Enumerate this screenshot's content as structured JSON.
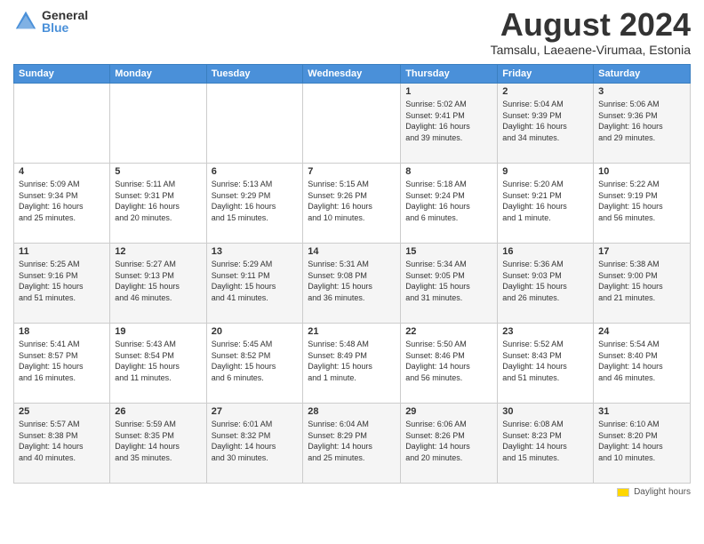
{
  "logo": {
    "general": "General",
    "blue": "Blue"
  },
  "header": {
    "month": "August 2024",
    "location": "Tamsalu, Laeaene-Virumaa, Estonia"
  },
  "days_of_week": [
    "Sunday",
    "Monday",
    "Tuesday",
    "Wednesday",
    "Thursday",
    "Friday",
    "Saturday"
  ],
  "weeks": [
    [
      {
        "day": "",
        "info": ""
      },
      {
        "day": "",
        "info": ""
      },
      {
        "day": "",
        "info": ""
      },
      {
        "day": "",
        "info": ""
      },
      {
        "day": "1",
        "info": "Sunrise: 5:02 AM\nSunset: 9:41 PM\nDaylight: 16 hours\nand 39 minutes."
      },
      {
        "day": "2",
        "info": "Sunrise: 5:04 AM\nSunset: 9:39 PM\nDaylight: 16 hours\nand 34 minutes."
      },
      {
        "day": "3",
        "info": "Sunrise: 5:06 AM\nSunset: 9:36 PM\nDaylight: 16 hours\nand 29 minutes."
      }
    ],
    [
      {
        "day": "4",
        "info": "Sunrise: 5:09 AM\nSunset: 9:34 PM\nDaylight: 16 hours\nand 25 minutes."
      },
      {
        "day": "5",
        "info": "Sunrise: 5:11 AM\nSunset: 9:31 PM\nDaylight: 16 hours\nand 20 minutes."
      },
      {
        "day": "6",
        "info": "Sunrise: 5:13 AM\nSunset: 9:29 PM\nDaylight: 16 hours\nand 15 minutes."
      },
      {
        "day": "7",
        "info": "Sunrise: 5:15 AM\nSunset: 9:26 PM\nDaylight: 16 hours\nand 10 minutes."
      },
      {
        "day": "8",
        "info": "Sunrise: 5:18 AM\nSunset: 9:24 PM\nDaylight: 16 hours\nand 6 minutes."
      },
      {
        "day": "9",
        "info": "Sunrise: 5:20 AM\nSunset: 9:21 PM\nDaylight: 16 hours\nand 1 minute."
      },
      {
        "day": "10",
        "info": "Sunrise: 5:22 AM\nSunset: 9:19 PM\nDaylight: 15 hours\nand 56 minutes."
      }
    ],
    [
      {
        "day": "11",
        "info": "Sunrise: 5:25 AM\nSunset: 9:16 PM\nDaylight: 15 hours\nand 51 minutes."
      },
      {
        "day": "12",
        "info": "Sunrise: 5:27 AM\nSunset: 9:13 PM\nDaylight: 15 hours\nand 46 minutes."
      },
      {
        "day": "13",
        "info": "Sunrise: 5:29 AM\nSunset: 9:11 PM\nDaylight: 15 hours\nand 41 minutes."
      },
      {
        "day": "14",
        "info": "Sunrise: 5:31 AM\nSunset: 9:08 PM\nDaylight: 15 hours\nand 36 minutes."
      },
      {
        "day": "15",
        "info": "Sunrise: 5:34 AM\nSunset: 9:05 PM\nDaylight: 15 hours\nand 31 minutes."
      },
      {
        "day": "16",
        "info": "Sunrise: 5:36 AM\nSunset: 9:03 PM\nDaylight: 15 hours\nand 26 minutes."
      },
      {
        "day": "17",
        "info": "Sunrise: 5:38 AM\nSunset: 9:00 PM\nDaylight: 15 hours\nand 21 minutes."
      }
    ],
    [
      {
        "day": "18",
        "info": "Sunrise: 5:41 AM\nSunset: 8:57 PM\nDaylight: 15 hours\nand 16 minutes."
      },
      {
        "day": "19",
        "info": "Sunrise: 5:43 AM\nSunset: 8:54 PM\nDaylight: 15 hours\nand 11 minutes."
      },
      {
        "day": "20",
        "info": "Sunrise: 5:45 AM\nSunset: 8:52 PM\nDaylight: 15 hours\nand 6 minutes."
      },
      {
        "day": "21",
        "info": "Sunrise: 5:48 AM\nSunset: 8:49 PM\nDaylight: 15 hours\nand 1 minute."
      },
      {
        "day": "22",
        "info": "Sunrise: 5:50 AM\nSunset: 8:46 PM\nDaylight: 14 hours\nand 56 minutes."
      },
      {
        "day": "23",
        "info": "Sunrise: 5:52 AM\nSunset: 8:43 PM\nDaylight: 14 hours\nand 51 minutes."
      },
      {
        "day": "24",
        "info": "Sunrise: 5:54 AM\nSunset: 8:40 PM\nDaylight: 14 hours\nand 46 minutes."
      }
    ],
    [
      {
        "day": "25",
        "info": "Sunrise: 5:57 AM\nSunset: 8:38 PM\nDaylight: 14 hours\nand 40 minutes."
      },
      {
        "day": "26",
        "info": "Sunrise: 5:59 AM\nSunset: 8:35 PM\nDaylight: 14 hours\nand 35 minutes."
      },
      {
        "day": "27",
        "info": "Sunrise: 6:01 AM\nSunset: 8:32 PM\nDaylight: 14 hours\nand 30 minutes."
      },
      {
        "day": "28",
        "info": "Sunrise: 6:04 AM\nSunset: 8:29 PM\nDaylight: 14 hours\nand 25 minutes."
      },
      {
        "day": "29",
        "info": "Sunrise: 6:06 AM\nSunset: 8:26 PM\nDaylight: 14 hours\nand 20 minutes."
      },
      {
        "day": "30",
        "info": "Sunrise: 6:08 AM\nSunset: 8:23 PM\nDaylight: 14 hours\nand 15 minutes."
      },
      {
        "day": "31",
        "info": "Sunrise: 6:10 AM\nSunset: 8:20 PM\nDaylight: 14 hours\nand 10 minutes."
      }
    ]
  ],
  "footer": {
    "daylight_label": "Daylight hours"
  }
}
